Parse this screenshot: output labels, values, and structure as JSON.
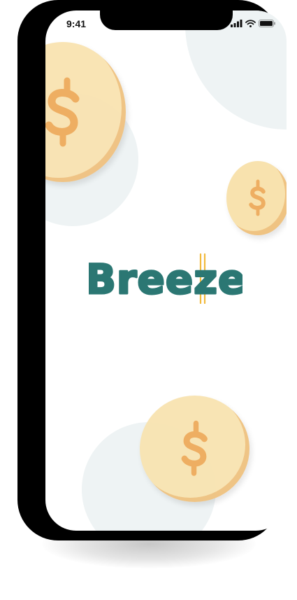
{
  "status_bar": {
    "time": "9:41",
    "icons": [
      "cellular-signal-icon",
      "wifi-icon",
      "battery-icon"
    ]
  },
  "brand": {
    "name": "Breeze",
    "color": "#2b7773",
    "accent_color": "#f1b93c"
  },
  "coins": [
    {
      "symbol": "$",
      "icon": "dollar-coin-icon"
    },
    {
      "symbol": "$",
      "icon": "dollar-coin-icon"
    },
    {
      "symbol": "$",
      "icon": "dollar-coin-icon"
    }
  ],
  "colors": {
    "coin_fill": "#f8e2ae",
    "coin_edge": "#e8aa5f",
    "dollar_glyph": "#eeae62",
    "background_blob": "#eef3f4",
    "phone_frame": "#000000"
  }
}
